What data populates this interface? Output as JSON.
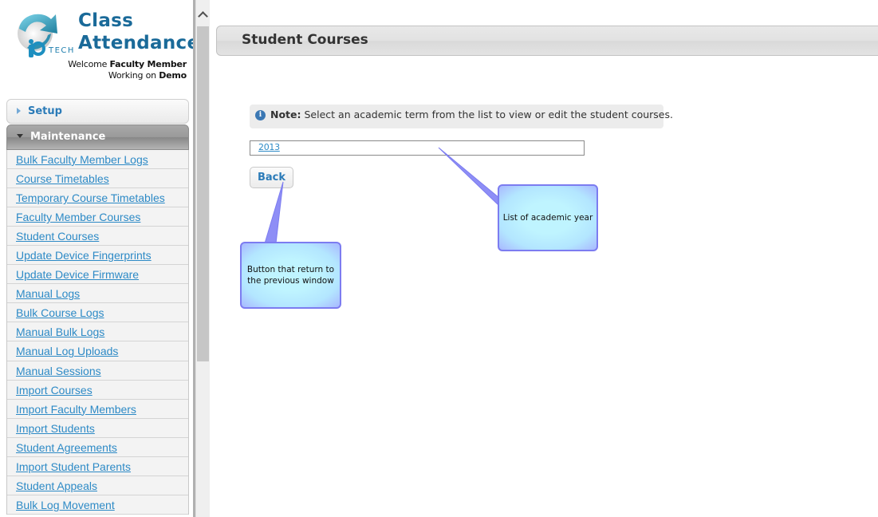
{
  "app": {
    "logo_text": "TECH",
    "title_line1": "Class",
    "title_line2": "Attendance",
    "welcome_prefix": "Welcome",
    "user_name": "Faculty Member",
    "working_prefix": "Working on",
    "workspace": "Demo"
  },
  "sidebar": {
    "sections": [
      {
        "label": "Setup",
        "state": "collapsed"
      },
      {
        "label": "Maintenance",
        "state": "expanded"
      }
    ],
    "items": [
      {
        "label": "Bulk Faculty Member Logs"
      },
      {
        "label": "Course Timetables"
      },
      {
        "label": "Temporary Course Timetables"
      },
      {
        "label": "Faculty Member Courses"
      },
      {
        "label": "Student Courses"
      },
      {
        "label": "Update Device Fingerprints"
      },
      {
        "label": "Update Device Firmware"
      },
      {
        "label": "Manual Logs"
      },
      {
        "label": "Bulk Course Logs"
      },
      {
        "label": "Manual Bulk Logs"
      },
      {
        "label": "Manual Log Uploads"
      },
      {
        "label": "Manual Sessions"
      },
      {
        "label": "Import Courses"
      },
      {
        "label": "Import Faculty Members"
      },
      {
        "label": "Import Students"
      },
      {
        "label": "Student Agreements"
      },
      {
        "label": "Import Student Parents"
      },
      {
        "label": "Student Appeals"
      },
      {
        "label": "Bulk Log Movement"
      }
    ]
  },
  "main": {
    "page_title": "Student Courses",
    "note": {
      "icon": "info-icon",
      "label": "Note:",
      "text": "Select an academic term from the list to view or edit the student courses."
    },
    "terms": [
      "2013"
    ],
    "back_label": "Back"
  },
  "callouts": {
    "back": "Button that return to the previous window",
    "list": "List of academic year"
  },
  "colors": {
    "brand": "#1a6a99",
    "link": "#2d8ac6",
    "callout_border": "#7c7cf0",
    "callout_fill": "#bff4ff"
  }
}
